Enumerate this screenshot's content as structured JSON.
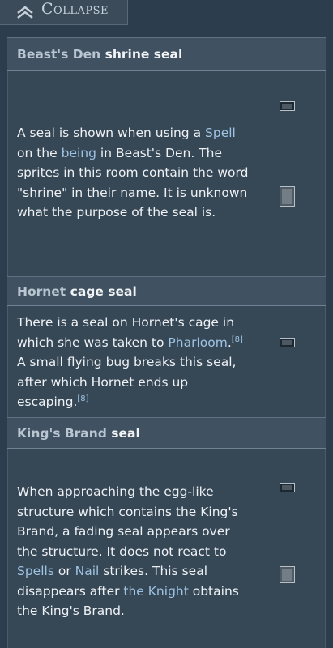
{
  "toolbar": {
    "collapse_label": "Collapse",
    "collapse_icon": "double-chevron-up-icon"
  },
  "sections": [
    {
      "title_link": "Beast's Den",
      "title_rest": "shrine seal",
      "body": [
        {
          "t": "A seal is shown when using a "
        },
        {
          "t": "Spell",
          "link": true
        },
        {
          "t": " on the "
        },
        {
          "t": "being",
          "link": true
        },
        {
          "t": " in Beast's Den. The sprites in this room contain the word \"shrine\" in their name. It is unknown what the purpose of the seal is."
        }
      ]
    },
    {
      "title_link": "Hornet",
      "title_rest": "cage seal",
      "body": [
        {
          "t": "There is a seal on Hornet's cage in which she was taken to "
        },
        {
          "t": "Pharloom",
          "link": true
        },
        {
          "t": "."
        },
        {
          "t": "[8]",
          "ref": true
        },
        {
          "t": " A small flying bug breaks this seal, after which Hornet ends up escaping."
        },
        {
          "t": "[8]",
          "ref": true
        }
      ]
    },
    {
      "title_link": "King's Brand",
      "title_rest": "seal",
      "body": [
        {
          "t": "When approaching the egg-like structure which contains the King's Brand, a fading seal appears over the structure. It does not react to "
        },
        {
          "t": "Spells",
          "link": true
        },
        {
          "t": " or "
        },
        {
          "t": "Nail",
          "link": true
        },
        {
          "t": " strikes. This seal disappears after "
        },
        {
          "t": "the Knight",
          "link": true
        },
        {
          "t": " obtains the King's Brand."
        }
      ]
    }
  ],
  "colors": {
    "background": "#2c3e4e",
    "panel": "#364756",
    "header": "#405261",
    "link": "#9fc3e2"
  }
}
